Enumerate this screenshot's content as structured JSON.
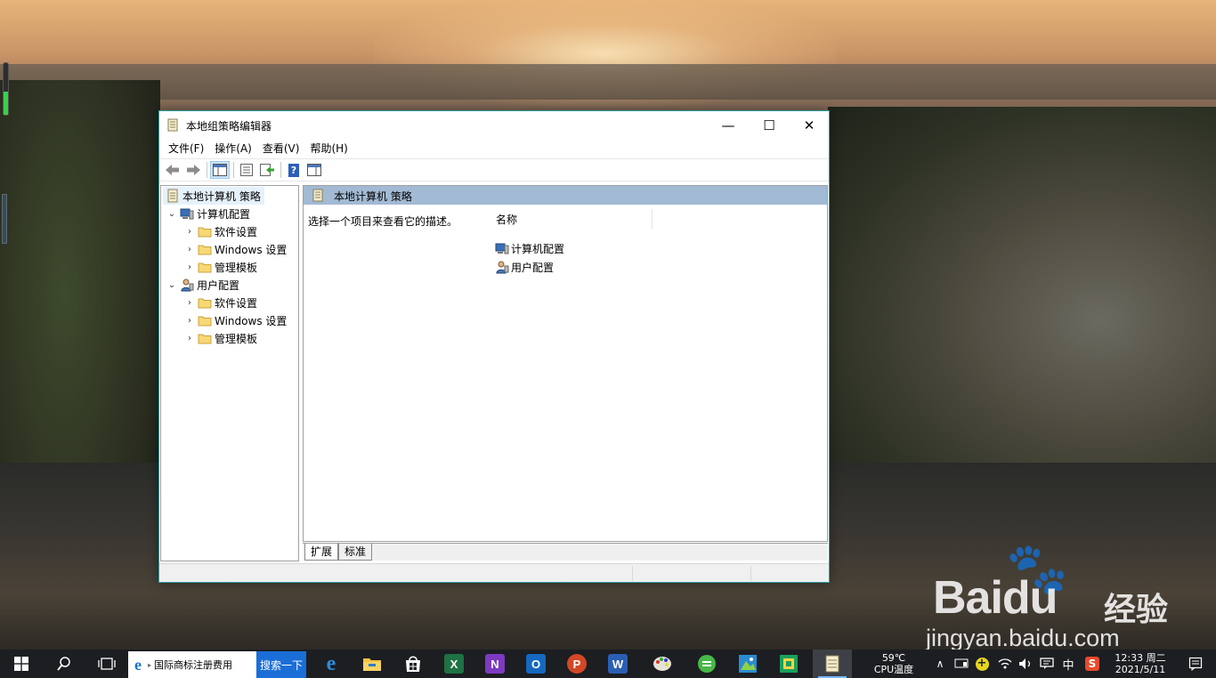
{
  "window": {
    "title": "本地组策略编辑器",
    "minimize": "—",
    "maximize": "☐",
    "close": "✕"
  },
  "menu": [
    "文件(F)",
    "操作(A)",
    "查看(V)",
    "帮助(H)"
  ],
  "toolbar": {
    "icons": [
      "back-icon",
      "forward-icon",
      "show-hide-tree-icon",
      "properties-icon",
      "export-list-icon",
      "help-icon",
      "show-action-pane-icon"
    ],
    "help_glyph": "?"
  },
  "tree": {
    "root": "本地计算机 策略",
    "computer": {
      "label": "计算机配置",
      "children": [
        "软件设置",
        "Windows 设置",
        "管理模板"
      ]
    },
    "user": {
      "label": "用户配置",
      "children": [
        "软件设置",
        "Windows 设置",
        "管理模板"
      ]
    }
  },
  "details": {
    "header": "本地计算机 策略",
    "description": "选择一个项目来查看它的描述。",
    "column_name": "名称",
    "items": [
      "计算机配置",
      "用户配置"
    ]
  },
  "tabs": [
    "扩展",
    "标准"
  ],
  "taskbar": {
    "search_text": "国际商标注册费用",
    "search_button": "搜索一下",
    "apps": [
      "edge-icon",
      "file-explorer-icon",
      "store-icon",
      "excel-icon",
      "onenote-icon",
      "outlook-icon",
      "powerpoint-icon",
      "word-icon",
      "paint-icon",
      "green-app-icon",
      "photo-app-icon",
      "green-square-app-icon",
      "notepad-icon"
    ],
    "excel_letter": "X",
    "onenote_letter": "N",
    "outlook_letter": "O",
    "powerpoint_letter": "P",
    "word_letter": "W",
    "temp": "59℃",
    "temp_label": "CPU温度",
    "ime": "中",
    "time": "12:33 周二",
    "date": "2021/5/11"
  },
  "watermark": {
    "brand": "Bai",
    "brand_du": "du",
    "brand_cn": "经验",
    "url": "jingyan.baidu.com"
  }
}
